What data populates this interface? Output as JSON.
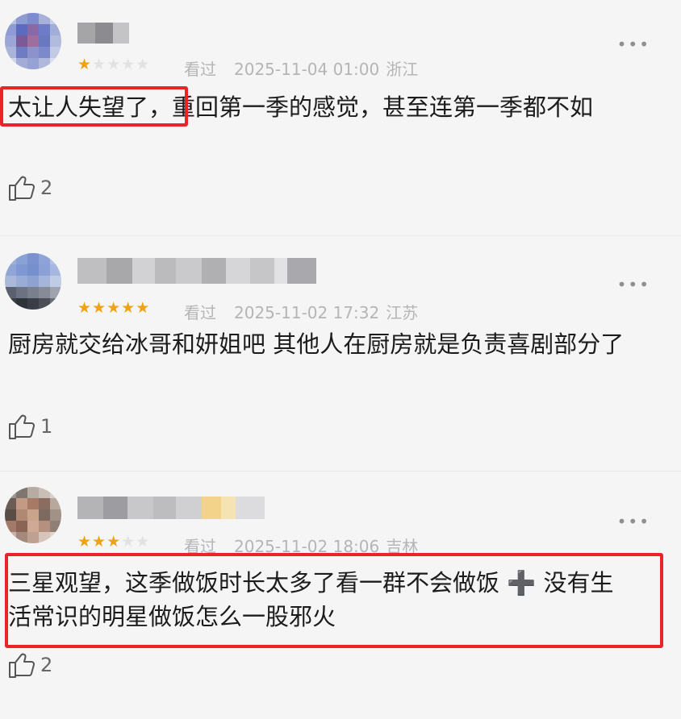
{
  "comments": [
    {
      "stars_filled": 1,
      "stars_total": 5,
      "watched_label": "看过",
      "timestamp": "2025-11-04 01:00",
      "location": "浙江",
      "text": "太让人失望了，重回第一季的感觉，甚至连第一季都不如",
      "highlighted_phrase": "太让人失望了，",
      "likes": "2",
      "more_label": "•••"
    },
    {
      "stars_filled": 5,
      "stars_total": 5,
      "watched_label": "看过",
      "timestamp": "2025-11-02 17:32",
      "location": "江苏",
      "text": "厨房就交给冰哥和妍姐吧 其他人在厨房就是负责喜剧部分了",
      "likes": "1",
      "more_label": "•••"
    },
    {
      "stars_filled": 3,
      "stars_total": 5,
      "watched_label": "看过",
      "timestamp": "2025-11-02 18:06",
      "location": "吉林",
      "text": "三星观望，这季做饭时长太多了看一群不会做饭 ➕ 没有生活常识的明星做饭怎么一股邪火",
      "likes": "2",
      "more_label": "•••"
    }
  ],
  "colors": {
    "star_filled": "#f0a215",
    "star_empty": "#e2e2e4",
    "highlight_border": "#e8232a",
    "meta_text": "#b5b5b7"
  }
}
